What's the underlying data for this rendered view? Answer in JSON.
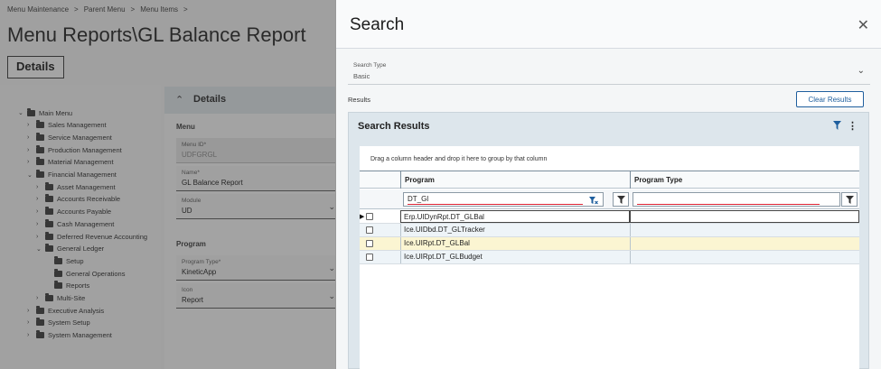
{
  "breadcrumb": [
    "Menu Maintenance",
    "Parent Menu",
    "Menu Items"
  ],
  "page_title": "Menu Reports\\GL Balance Report",
  "tab_details": "Details",
  "tree": [
    {
      "label": "Main Menu",
      "level": 0,
      "expanded": true
    },
    {
      "label": "Sales Management",
      "level": 1,
      "expanded": false
    },
    {
      "label": "Service Management",
      "level": 1,
      "expanded": false
    },
    {
      "label": "Production Management",
      "level": 1,
      "expanded": false
    },
    {
      "label": "Material Management",
      "level": 1,
      "expanded": false
    },
    {
      "label": "Financial Management",
      "level": 1,
      "expanded": true
    },
    {
      "label": "Asset Management",
      "level": 2,
      "expanded": false
    },
    {
      "label": "Accounts Receivable",
      "level": 2,
      "expanded": false
    },
    {
      "label": "Accounts Payable",
      "level": 2,
      "expanded": false
    },
    {
      "label": "Cash Management",
      "level": 2,
      "expanded": false
    },
    {
      "label": "Deferred Revenue Accounting",
      "level": 2,
      "expanded": false
    },
    {
      "label": "General Ledger",
      "level": 2,
      "expanded": true
    },
    {
      "label": "Setup",
      "level": 3,
      "expanded": null
    },
    {
      "label": "General Operations",
      "level": 3,
      "expanded": null
    },
    {
      "label": "Reports",
      "level": 3,
      "expanded": null
    },
    {
      "label": "Multi-Site",
      "level": 2,
      "expanded": false
    },
    {
      "label": "Executive Analysis",
      "level": 1,
      "expanded": false
    },
    {
      "label": "System Setup",
      "level": 1,
      "expanded": false
    },
    {
      "label": "System Management",
      "level": 1,
      "expanded": false
    }
  ],
  "details": {
    "title": "Details",
    "menu_section": "Menu",
    "menu_id_label": "Menu ID*",
    "menu_id_value": "UDFGRGL",
    "name_label": "Name*",
    "name_value": "GL Balance Report",
    "module_label": "Module",
    "module_value": "UD",
    "program_section": "Program",
    "program_type_label": "Program Type*",
    "program_type_value": "KineticApp",
    "icon_label": "Icon",
    "icon_value": "Report"
  },
  "search": {
    "title": "Search",
    "search_type_label": "Search Type",
    "search_type_value": "Basic",
    "results_label": "Results",
    "clear_results_label": "Clear Results",
    "card_title": "Search Results",
    "group_hint": "Drag a column header and drop it here to group by that column",
    "columns": [
      "Program",
      "Program Type"
    ],
    "filter_program": "DT_Gl",
    "filter_program_type": "",
    "rows": [
      {
        "program": "Erp.UIDynRpt.DT_GLBal",
        "program_type": ""
      },
      {
        "program": "Ice.UIDbd.DT_GLTracker",
        "program_type": ""
      },
      {
        "program": "Ice.UIRpt.DT_GLBal",
        "program_type": ""
      },
      {
        "program": "Ice.UIRpt.DT_GLBudget",
        "program_type": ""
      }
    ]
  },
  "colors": {
    "accent": "#1f5f9e",
    "highlight_row": "#fbf5d2",
    "card_bg": "#dde6ec"
  }
}
